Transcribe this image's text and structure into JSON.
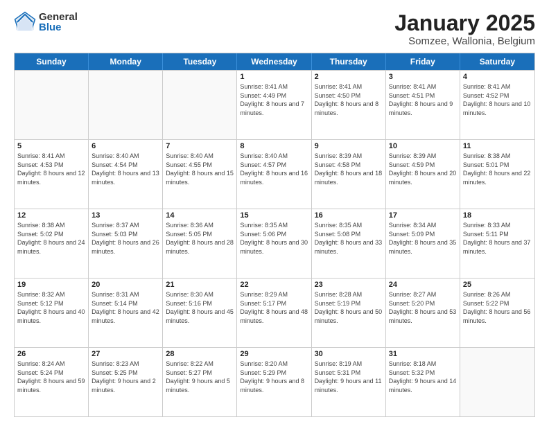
{
  "logo": {
    "general": "General",
    "blue": "Blue"
  },
  "title": {
    "month": "January 2025",
    "location": "Somzee, Wallonia, Belgium"
  },
  "header": {
    "days": [
      "Sunday",
      "Monday",
      "Tuesday",
      "Wednesday",
      "Thursday",
      "Friday",
      "Saturday"
    ]
  },
  "weeks": [
    {
      "cells": [
        {
          "day": "",
          "empty": true
        },
        {
          "day": "",
          "empty": true
        },
        {
          "day": "",
          "empty": true
        },
        {
          "day": "1",
          "sunrise": "8:41 AM",
          "sunset": "4:49 PM",
          "daylight": "8 hours and 7 minutes."
        },
        {
          "day": "2",
          "sunrise": "8:41 AM",
          "sunset": "4:50 PM",
          "daylight": "8 hours and 8 minutes."
        },
        {
          "day": "3",
          "sunrise": "8:41 AM",
          "sunset": "4:51 PM",
          "daylight": "8 hours and 9 minutes."
        },
        {
          "day": "4",
          "sunrise": "8:41 AM",
          "sunset": "4:52 PM",
          "daylight": "8 hours and 10 minutes."
        }
      ]
    },
    {
      "cells": [
        {
          "day": "5",
          "sunrise": "8:41 AM",
          "sunset": "4:53 PM",
          "daylight": "8 hours and 12 minutes."
        },
        {
          "day": "6",
          "sunrise": "8:40 AM",
          "sunset": "4:54 PM",
          "daylight": "8 hours and 13 minutes."
        },
        {
          "day": "7",
          "sunrise": "8:40 AM",
          "sunset": "4:55 PM",
          "daylight": "8 hours and 15 minutes."
        },
        {
          "day": "8",
          "sunrise": "8:40 AM",
          "sunset": "4:57 PM",
          "daylight": "8 hours and 16 minutes."
        },
        {
          "day": "9",
          "sunrise": "8:39 AM",
          "sunset": "4:58 PM",
          "daylight": "8 hours and 18 minutes."
        },
        {
          "day": "10",
          "sunrise": "8:39 AM",
          "sunset": "4:59 PM",
          "daylight": "8 hours and 20 minutes."
        },
        {
          "day": "11",
          "sunrise": "8:38 AM",
          "sunset": "5:01 PM",
          "daylight": "8 hours and 22 minutes."
        }
      ]
    },
    {
      "cells": [
        {
          "day": "12",
          "sunrise": "8:38 AM",
          "sunset": "5:02 PM",
          "daylight": "8 hours and 24 minutes."
        },
        {
          "day": "13",
          "sunrise": "8:37 AM",
          "sunset": "5:03 PM",
          "daylight": "8 hours and 26 minutes."
        },
        {
          "day": "14",
          "sunrise": "8:36 AM",
          "sunset": "5:05 PM",
          "daylight": "8 hours and 28 minutes."
        },
        {
          "day": "15",
          "sunrise": "8:35 AM",
          "sunset": "5:06 PM",
          "daylight": "8 hours and 30 minutes."
        },
        {
          "day": "16",
          "sunrise": "8:35 AM",
          "sunset": "5:08 PM",
          "daylight": "8 hours and 33 minutes."
        },
        {
          "day": "17",
          "sunrise": "8:34 AM",
          "sunset": "5:09 PM",
          "daylight": "8 hours and 35 minutes."
        },
        {
          "day": "18",
          "sunrise": "8:33 AM",
          "sunset": "5:11 PM",
          "daylight": "8 hours and 37 minutes."
        }
      ]
    },
    {
      "cells": [
        {
          "day": "19",
          "sunrise": "8:32 AM",
          "sunset": "5:12 PM",
          "daylight": "8 hours and 40 minutes."
        },
        {
          "day": "20",
          "sunrise": "8:31 AM",
          "sunset": "5:14 PM",
          "daylight": "8 hours and 42 minutes."
        },
        {
          "day": "21",
          "sunrise": "8:30 AM",
          "sunset": "5:16 PM",
          "daylight": "8 hours and 45 minutes."
        },
        {
          "day": "22",
          "sunrise": "8:29 AM",
          "sunset": "5:17 PM",
          "daylight": "8 hours and 48 minutes."
        },
        {
          "day": "23",
          "sunrise": "8:28 AM",
          "sunset": "5:19 PM",
          "daylight": "8 hours and 50 minutes."
        },
        {
          "day": "24",
          "sunrise": "8:27 AM",
          "sunset": "5:20 PM",
          "daylight": "8 hours and 53 minutes."
        },
        {
          "day": "25",
          "sunrise": "8:26 AM",
          "sunset": "5:22 PM",
          "daylight": "8 hours and 56 minutes."
        }
      ]
    },
    {
      "cells": [
        {
          "day": "26",
          "sunrise": "8:24 AM",
          "sunset": "5:24 PM",
          "daylight": "8 hours and 59 minutes."
        },
        {
          "day": "27",
          "sunrise": "8:23 AM",
          "sunset": "5:25 PM",
          "daylight": "9 hours and 2 minutes."
        },
        {
          "day": "28",
          "sunrise": "8:22 AM",
          "sunset": "5:27 PM",
          "daylight": "9 hours and 5 minutes."
        },
        {
          "day": "29",
          "sunrise": "8:20 AM",
          "sunset": "5:29 PM",
          "daylight": "9 hours and 8 minutes."
        },
        {
          "day": "30",
          "sunrise": "8:19 AM",
          "sunset": "5:31 PM",
          "daylight": "9 hours and 11 minutes."
        },
        {
          "day": "31",
          "sunrise": "8:18 AM",
          "sunset": "5:32 PM",
          "daylight": "9 hours and 14 minutes."
        },
        {
          "day": "",
          "empty": true
        }
      ]
    }
  ]
}
